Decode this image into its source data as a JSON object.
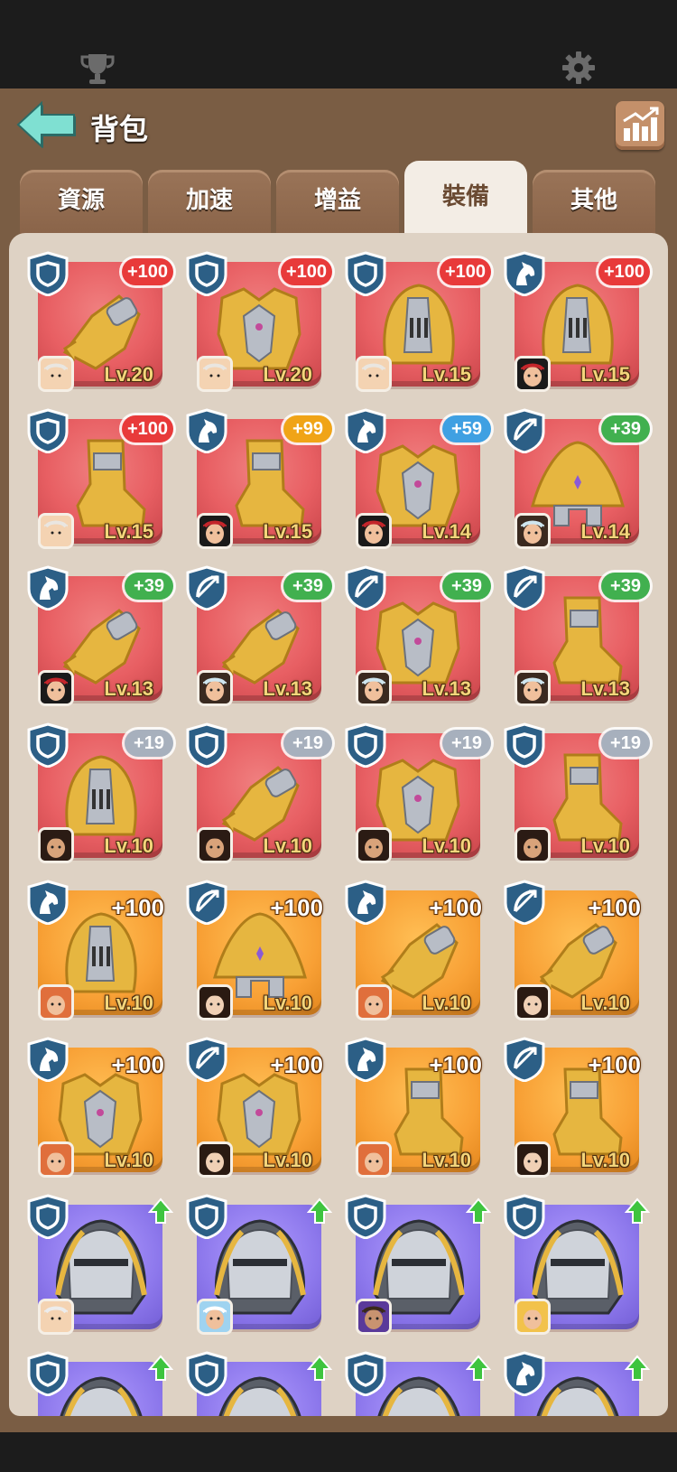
{
  "header": {
    "title": "背包"
  },
  "tabs": [
    {
      "label": "資源",
      "active": false
    },
    {
      "label": "加速",
      "active": false
    },
    {
      "label": "增益",
      "active": false
    },
    {
      "label": "裝備",
      "active": true
    },
    {
      "label": "其他",
      "active": false
    }
  ],
  "colors": {
    "accent_back": "#5fd0c0",
    "card_red": "#e85f63",
    "card_orange": "#f8a035",
    "card_purple": "#8d78ec",
    "level_text": "#f3d57b"
  },
  "items": [
    {
      "class": "shield-icon",
      "rarity": "red",
      "bonus": "+100",
      "bonus_color": "red",
      "equip": "gauntlet",
      "avatar": "white-beard",
      "level": "Lv.20"
    },
    {
      "class": "shield-icon",
      "rarity": "red",
      "bonus": "+100",
      "bonus_color": "red",
      "equip": "armor",
      "avatar": "white-beard",
      "level": "Lv.20"
    },
    {
      "class": "shield-icon",
      "rarity": "red",
      "bonus": "+100",
      "bonus_color": "red",
      "equip": "helmet",
      "avatar": "white-beard",
      "level": "Lv.15"
    },
    {
      "class": "horse-icon",
      "rarity": "red",
      "bonus": "+100",
      "bonus_color": "red",
      "equip": "helmet",
      "avatar": "red-hair",
      "level": "Lv.15"
    },
    {
      "class": "shield-icon",
      "rarity": "red",
      "bonus": "+100",
      "bonus_color": "red",
      "equip": "boot",
      "avatar": "white-beard",
      "level": "Lv.15"
    },
    {
      "class": "horse-icon",
      "rarity": "red",
      "bonus": "+99",
      "bonus_color": "yellow",
      "equip": "boot",
      "avatar": "red-hair",
      "level": "Lv.15"
    },
    {
      "class": "horse-icon",
      "rarity": "red",
      "bonus": "+59",
      "bonus_color": "blue",
      "equip": "armor",
      "avatar": "red-hair",
      "level": "Lv.14"
    },
    {
      "class": "bow-icon",
      "rarity": "red",
      "bonus": "+39",
      "bonus_color": "green",
      "equip": "hat",
      "avatar": "goggles",
      "level": "Lv.14"
    },
    {
      "class": "horse-icon",
      "rarity": "red",
      "bonus": "+39",
      "bonus_color": "green",
      "equip": "gauntlet",
      "avatar": "red-hair",
      "level": "Lv.13"
    },
    {
      "class": "bow-icon",
      "rarity": "red",
      "bonus": "+39",
      "bonus_color": "green",
      "equip": "gauntlet",
      "avatar": "goggles",
      "level": "Lv.13"
    },
    {
      "class": "bow-icon",
      "rarity": "red",
      "bonus": "+39",
      "bonus_color": "green",
      "equip": "armor",
      "avatar": "goggles",
      "level": "Lv.13"
    },
    {
      "class": "bow-icon",
      "rarity": "red",
      "bonus": "+39",
      "bonus_color": "green",
      "equip": "boot",
      "avatar": "goggles",
      "level": "Lv.13"
    },
    {
      "class": "shield-icon",
      "rarity": "red",
      "bonus": "+19",
      "bonus_color": "gray",
      "equip": "helmet",
      "avatar": "dark-hair",
      "level": "Lv.10"
    },
    {
      "class": "shield-icon",
      "rarity": "red",
      "bonus": "+19",
      "bonus_color": "gray",
      "equip": "gauntlet",
      "avatar": "dark-hair",
      "level": "Lv.10"
    },
    {
      "class": "shield-icon",
      "rarity": "red",
      "bonus": "+19",
      "bonus_color": "gray",
      "equip": "armor",
      "avatar": "dark-hair",
      "level": "Lv.10"
    },
    {
      "class": "shield-icon",
      "rarity": "red",
      "bonus": "+19",
      "bonus_color": "gray",
      "equip": "boot",
      "avatar": "dark-hair",
      "level": "Lv.10"
    },
    {
      "class": "horse-icon",
      "rarity": "orange",
      "bonus": "+100",
      "equip": "helmet",
      "avatar": "ginger",
      "level": "Lv.10"
    },
    {
      "class": "bow-icon",
      "rarity": "orange",
      "bonus": "+100",
      "equip": "hat",
      "avatar": "bob-hair",
      "level": "Lv.10"
    },
    {
      "class": "horse-icon",
      "rarity": "orange",
      "bonus": "+100",
      "equip": "gauntlet",
      "avatar": "ginger",
      "level": "Lv.10"
    },
    {
      "class": "bow-icon",
      "rarity": "orange",
      "bonus": "+100",
      "equip": "gauntlet",
      "avatar": "bob-hair",
      "level": "Lv.10"
    },
    {
      "class": "horse-icon",
      "rarity": "orange",
      "bonus": "+100",
      "equip": "armor",
      "avatar": "ginger",
      "level": "Lv.10"
    },
    {
      "class": "bow-icon",
      "rarity": "orange",
      "bonus": "+100",
      "equip": "armor",
      "avatar": "bob-hair",
      "level": "Lv.10"
    },
    {
      "class": "horse-icon",
      "rarity": "orange",
      "bonus": "+100",
      "equip": "boot",
      "avatar": "ginger",
      "level": "Lv.10"
    },
    {
      "class": "bow-icon",
      "rarity": "orange",
      "bonus": "+100",
      "equip": "boot",
      "avatar": "bob-hair",
      "level": "Lv.10"
    },
    {
      "class": "shield-icon",
      "rarity": "purple",
      "upgrade": true,
      "equip": "visor-helmet",
      "avatar": "old-man",
      "level": ""
    },
    {
      "class": "shield-icon",
      "rarity": "purple",
      "upgrade": true,
      "equip": "visor-helmet",
      "avatar": "zeus",
      "level": ""
    },
    {
      "class": "shield-icon",
      "rarity": "purple",
      "upgrade": true,
      "equip": "visor-helmet",
      "avatar": "hooded",
      "level": ""
    },
    {
      "class": "shield-icon",
      "rarity": "purple",
      "upgrade": true,
      "equip": "visor-helmet",
      "avatar": "blonde",
      "level": ""
    },
    {
      "class": "shield-icon",
      "rarity": "purple",
      "upgrade": true,
      "equip": "visor-helmet",
      "avatar": "",
      "level": ""
    },
    {
      "class": "shield-icon",
      "rarity": "purple",
      "upgrade": true,
      "equip": "visor-helmet",
      "avatar": "",
      "level": ""
    },
    {
      "class": "shield-icon",
      "rarity": "purple",
      "upgrade": true,
      "equip": "visor-helmet",
      "avatar": "",
      "level": ""
    },
    {
      "class": "horse-icon",
      "rarity": "purple",
      "upgrade": true,
      "equip": "visor-helmet",
      "avatar": "",
      "level": ""
    }
  ]
}
